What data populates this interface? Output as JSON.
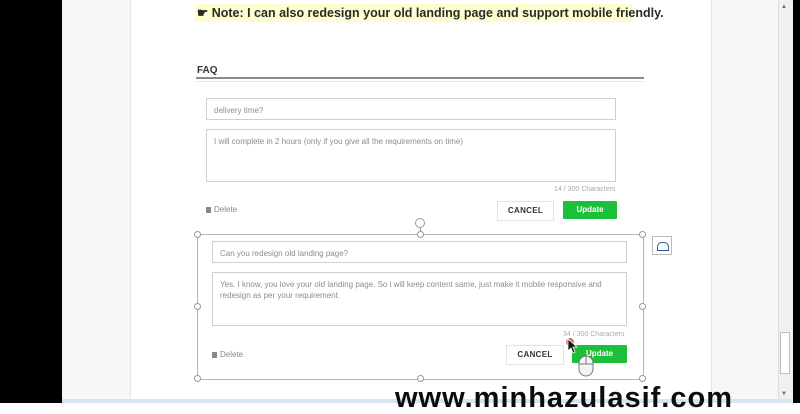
{
  "note": {
    "icon": "☛",
    "text": "Note: I can also redesign your old landing page and support mobile friendly."
  },
  "faq": {
    "title": "FAQ"
  },
  "item1": {
    "question": "delivery time?",
    "answer": "I will complete in 2 hours (only if you give all the requirements on time)",
    "counter": "14 / 300 Characters",
    "delete_label": "Delete",
    "cancel_label": "CANCEL",
    "update_label": "Update"
  },
  "item2": {
    "question": "Can you redesign old landing page?",
    "answer": "Yes. I know, you love your old landing page. So i will keep content same, just make it mobile responsive and redesign as per your requirement.",
    "counter": "34 / 300 Characters",
    "delete_label": "Delete",
    "cancel_label": "CANCEL",
    "update_label": "Update"
  },
  "watermark": "www.minhazulasif.com",
  "colors": {
    "update_button": "#1dbf3a",
    "note_highlight": "#fdfdcf"
  }
}
